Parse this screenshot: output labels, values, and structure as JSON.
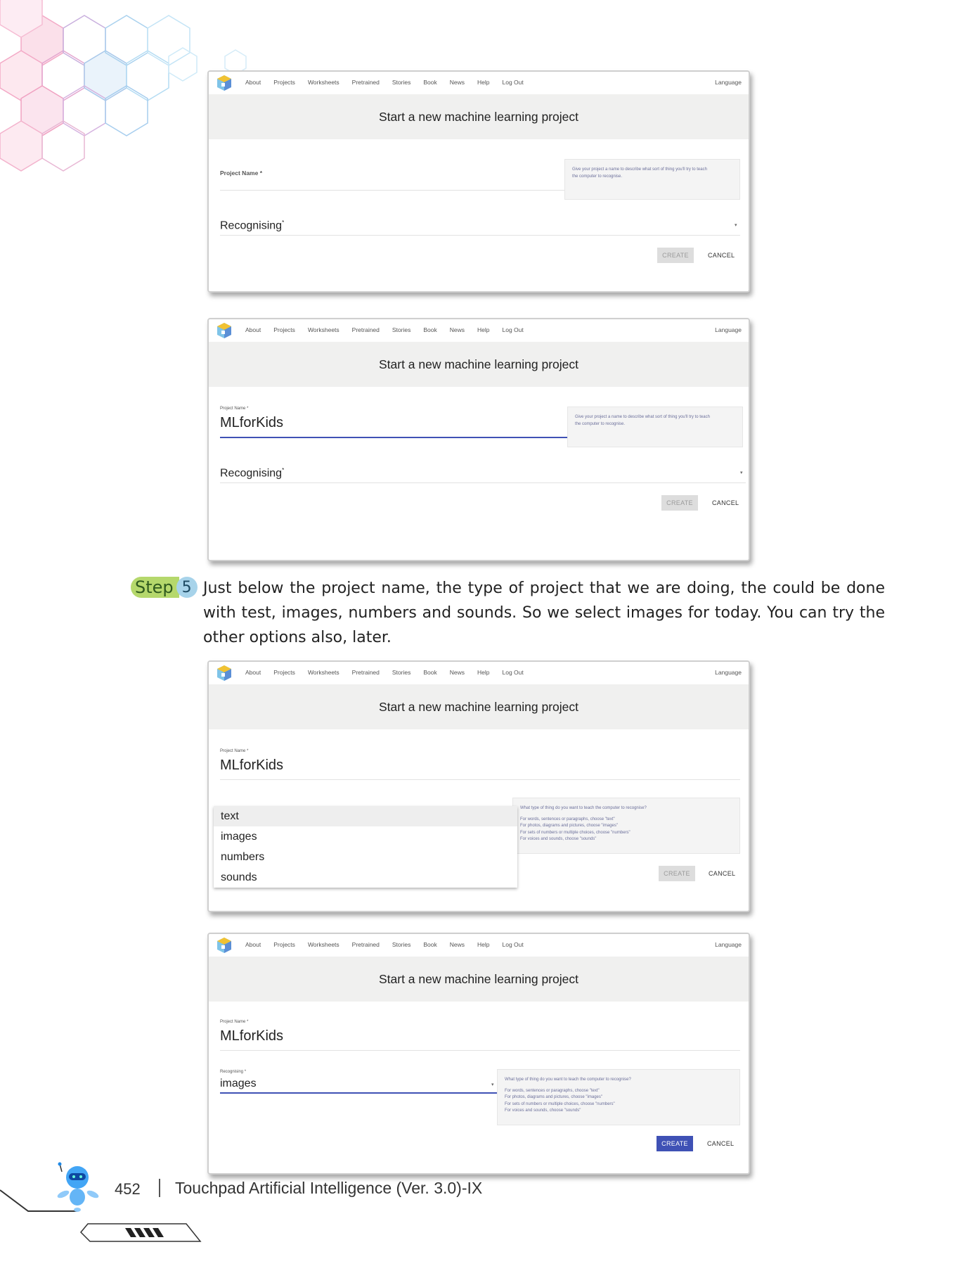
{
  "screens": [
    {
      "nav": [
        "About",
        "Projects",
        "Worksheets",
        "Pretrained",
        "Stories",
        "Book",
        "News",
        "Help",
        "Log Out"
      ],
      "language": "Language",
      "heading": "Start a new machine learning project",
      "project_label": "Project Name *",
      "project_value": "",
      "help_lines": [
        "Give your project a name to describe what sort of thing you'll try to teach",
        "the computer to recognise."
      ],
      "type_label": "Recognising",
      "create": "CREATE",
      "cancel": "CANCEL"
    },
    {
      "nav": [
        "About",
        "Projects",
        "Worksheets",
        "Pretrained",
        "Stories",
        "Book",
        "News",
        "Help",
        "Log Out"
      ],
      "language": "Language",
      "heading": "Start a new machine learning project",
      "project_label": "Project Name *",
      "project_value": "MLforKids",
      "help_lines": [
        "Give your project a name to describe what sort of thing you'll try to teach",
        "the computer to recognise."
      ],
      "type_label": "Recognising",
      "create": "CREATE",
      "cancel": "CANCEL"
    },
    {
      "nav": [
        "About",
        "Projects",
        "Worksheets",
        "Pretrained",
        "Stories",
        "Book",
        "News",
        "Help",
        "Log Out"
      ],
      "language": "Language",
      "heading": "Start a new machine learning project",
      "project_label": "Project Name *",
      "project_value": "MLforKids",
      "options": [
        "text",
        "images",
        "numbers",
        "sounds"
      ],
      "help_lines": [
        "What type of thing do you want to teach the computer to recognise?",
        "",
        "For words, sentences or paragraphs, choose \"text\"",
        "For photos, diagrams and pictures, choose \"images\"",
        "For sets of numbers or multiple choices, choose \"numbers\"",
        "For voices and sounds, choose \"sounds\""
      ],
      "create": "CREATE",
      "cancel": "CANCEL"
    },
    {
      "nav": [
        "About",
        "Projects",
        "Worksheets",
        "Pretrained",
        "Stories",
        "Book",
        "News",
        "Help",
        "Log Out"
      ],
      "language": "Language",
      "heading": "Start a new machine learning project",
      "project_label": "Project Name *",
      "project_value": "MLforKids",
      "type_small_label": "Recognising *",
      "type_value": "images",
      "help_lines": [
        "What type of thing do you want to teach the computer to recognise?",
        "",
        "For words, sentences or paragraphs, choose \"text\"",
        "For photos, diagrams and pictures, choose \"images\"",
        "For sets of numbers or multiple choices, choose \"numbers\"",
        "For voices and sounds, choose \"sounds\""
      ],
      "create": "CREATE",
      "cancel": "CANCEL"
    }
  ],
  "step": {
    "word": "Step",
    "number": "5",
    "text": "Just below the project name, the type of project that we are doing, the could be done with test, images, numbers and sounds. So we select images for today. You can try the other options also, later."
  },
  "footer": {
    "page_number": "452",
    "title": "Touchpad Artificial Intelligence (Ver. 3.0)-IX"
  },
  "colors": {
    "accent": "#3f51b5",
    "step_green": "#b5d86c",
    "step_blue": "#a7d3ea"
  }
}
